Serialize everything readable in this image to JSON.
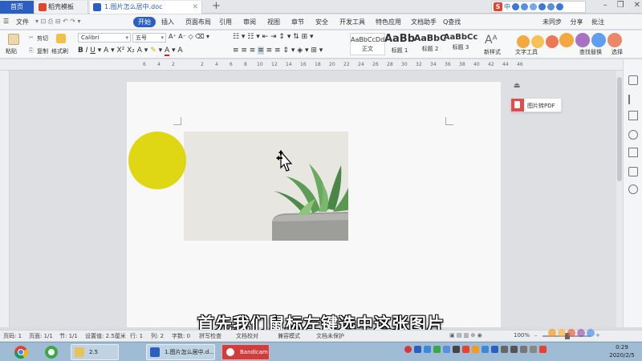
{
  "tabs": {
    "home": "首页",
    "templates": "稻壳模板",
    "document": "1.图片怎么居中.doc"
  },
  "ime": {
    "zh": "中"
  },
  "menu": {
    "file": "文件",
    "start": "开始",
    "items": [
      "插入",
      "页面布局",
      "引用",
      "审阅",
      "视图",
      "章节",
      "安全",
      "开发工具",
      "特色应用",
      "文档助手"
    ],
    "search": "Q查找",
    "unsync": "未同步",
    "share": "分享",
    "annotate": "批注"
  },
  "ribbon": {
    "paste": "粘贴",
    "cut": "剪切",
    "copy": "复制",
    "format_painter": "格式刷",
    "font_name": "Calibri",
    "font_size": "五号",
    "styles": [
      {
        "sample": "AaBbCcDd",
        "name": "正文"
      },
      {
        "sample": "AaBb",
        "name": "标题 1"
      },
      {
        "sample": "AaBbC",
        "name": "标题 2"
      },
      {
        "sample": "AaBbCc",
        "name": "标题 3"
      }
    ],
    "new_style": "新样式",
    "text_tools": "文字工具",
    "find_replace": "查找替换",
    "select": "选择"
  },
  "ruler_ticks": [
    "6",
    "4",
    "2",
    "2",
    "4",
    "6",
    "8",
    "10",
    "12",
    "14",
    "16",
    "18",
    "20",
    "22",
    "24",
    "26",
    "28",
    "30",
    "32",
    "34",
    "36",
    "38",
    "40",
    "42",
    "44",
    "46"
  ],
  "float": {
    "pdf_button": "图片转PDF"
  },
  "subtitle": "首先我们鼠标左键选中这张图片",
  "statusbar": {
    "page_num": "页码: 1",
    "pages": "页面: 1/1",
    "section": "节: 1/1",
    "setting": "设置值: 2.5厘米",
    "row": "行: 1",
    "col": "列: 2",
    "words": "字数: 0",
    "spell": "拼写检查",
    "proof": "文档校对",
    "compat": "兼容模式",
    "unprotected": "文档未保护",
    "zoom": "100%"
  },
  "taskbar": {
    "folder": "2.5",
    "doc": "1.图片怎么居中.d...",
    "bandicam": "Bandicam",
    "time": "0:29",
    "date": "2020/2/5"
  },
  "colors": {
    "accent": "#2b5fc1",
    "highlight": "#dcd400",
    "pdf": "#e04c4c"
  }
}
